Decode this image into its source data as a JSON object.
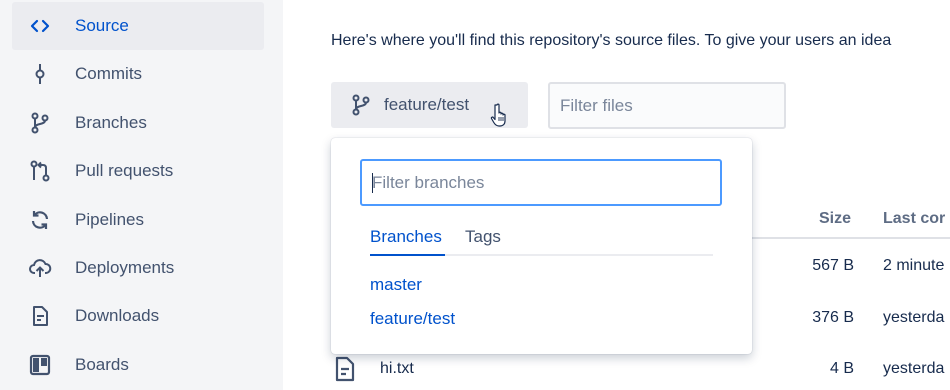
{
  "sidebar": {
    "items": [
      {
        "label": "Source",
        "icon": "code-icon",
        "active": true
      },
      {
        "label": "Commits",
        "icon": "commit-icon"
      },
      {
        "label": "Branches",
        "icon": "branch-icon"
      },
      {
        "label": "Pull requests",
        "icon": "pull-request-icon"
      },
      {
        "label": "Pipelines",
        "icon": "pipelines-icon"
      },
      {
        "label": "Deployments",
        "icon": "deployments-icon"
      },
      {
        "label": "Downloads",
        "icon": "downloads-icon"
      },
      {
        "label": "Boards",
        "icon": "boards-icon"
      }
    ]
  },
  "main": {
    "intro": "Here's where you'll find this repository's source files. To give your users an idea",
    "branch_selector": {
      "label": "feature/test"
    },
    "filter_files": {
      "placeholder": "Filter files"
    }
  },
  "dropdown": {
    "filter": {
      "placeholder": "Filter branches"
    },
    "tabs": [
      {
        "label": "Branches",
        "active": true
      },
      {
        "label": "Tags"
      }
    ],
    "branches": [
      "master",
      "feature/test"
    ]
  },
  "table": {
    "headers": {
      "size": "Size",
      "last_commit": "Last cor"
    },
    "rows": [
      {
        "name": "",
        "size": "567 B",
        "last_commit": "2 minute"
      },
      {
        "name": "",
        "size": "376 B",
        "last_commit": "yesterda"
      },
      {
        "name": "hi.txt",
        "size": "4 B",
        "last_commit": "yesterda"
      }
    ]
  },
  "colors": {
    "accent": "#0052cc",
    "sidebar_bg": "#f4f5f7",
    "focus_border": "#4c9aff",
    "text": "#172b4d",
    "muted_text": "#42526e"
  }
}
